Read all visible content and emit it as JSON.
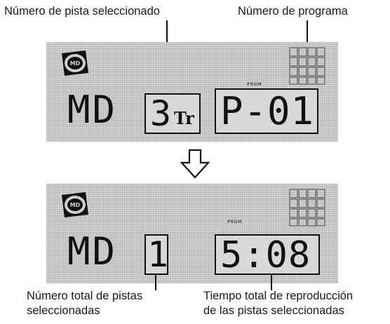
{
  "labels": {
    "selected_track_number": "Número de pista seleccionado",
    "program_number": "Número de programa",
    "total_tracks_line1": "Número total de pistas",
    "total_tracks_line2": "seleccionadas",
    "total_time_line1": "Tiempo total de reproducción",
    "total_time_line2": "de las pistas seleccionadas"
  },
  "display_top": {
    "source": "MD",
    "disc_icon_text": "MD",
    "prgm_indicator": "PRGM",
    "track_number": "3",
    "track_suffix": "Tr",
    "program": "P-01"
  },
  "display_bottom": {
    "source": "MD",
    "disc_icon_text": "MD",
    "prgm_indicator": "PRGM",
    "total_tracks": "1",
    "total_time": "5:08"
  },
  "icons": {
    "arrow": "hollow-down-arrow-icon",
    "disc": "minidisc-icon",
    "track_grid": "track-grid-icon"
  },
  "colors": {
    "lcd_background": "#cfcfcf",
    "ink": "#111111"
  }
}
